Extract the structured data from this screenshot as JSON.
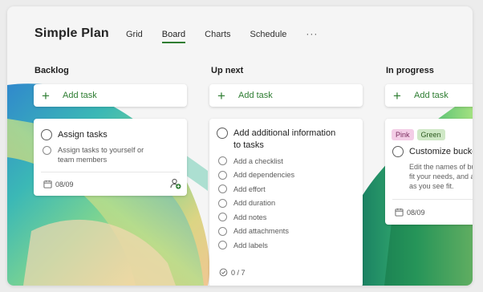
{
  "plan": {
    "title": "Simple Plan"
  },
  "tabs": [
    {
      "label": "Grid",
      "active": false
    },
    {
      "label": "Board",
      "active": true
    },
    {
      "label": "Charts",
      "active": false
    },
    {
      "label": "Schedule",
      "active": false
    }
  ],
  "more_label": "···",
  "add_task_label": "Add task",
  "buckets": [
    {
      "title": "Backlog",
      "tasks": [
        {
          "title": "Assign tasks",
          "subtasks": [
            "Assign tasks to yourself or team members"
          ],
          "due_date": "08/09",
          "assign_icon": "person-add-icon"
        }
      ]
    },
    {
      "title": "Up next",
      "tasks": [
        {
          "title_lines": [
            "Add additional information",
            "to tasks"
          ],
          "subtasks": [
            "Add a checklist",
            "Add dependencies",
            "Add effort",
            "Add duration",
            "Add notes",
            "Add attachments",
            "Add labels"
          ],
          "checklist_progress": "0 / 7"
        }
      ]
    },
    {
      "title": "In progress",
      "tasks": [
        {
          "labels": [
            "Pink",
            "Green"
          ],
          "title": "Customize bucket",
          "description_lines": [
            "Edit the names of buck",
            "fit your needs, and a",
            "as you see fit."
          ],
          "due_date": "08/09"
        }
      ]
    }
  ],
  "colors": {
    "accent": "#2e7d32",
    "label_pink": "#f3cde6",
    "label_green": "#cfe8c6"
  }
}
